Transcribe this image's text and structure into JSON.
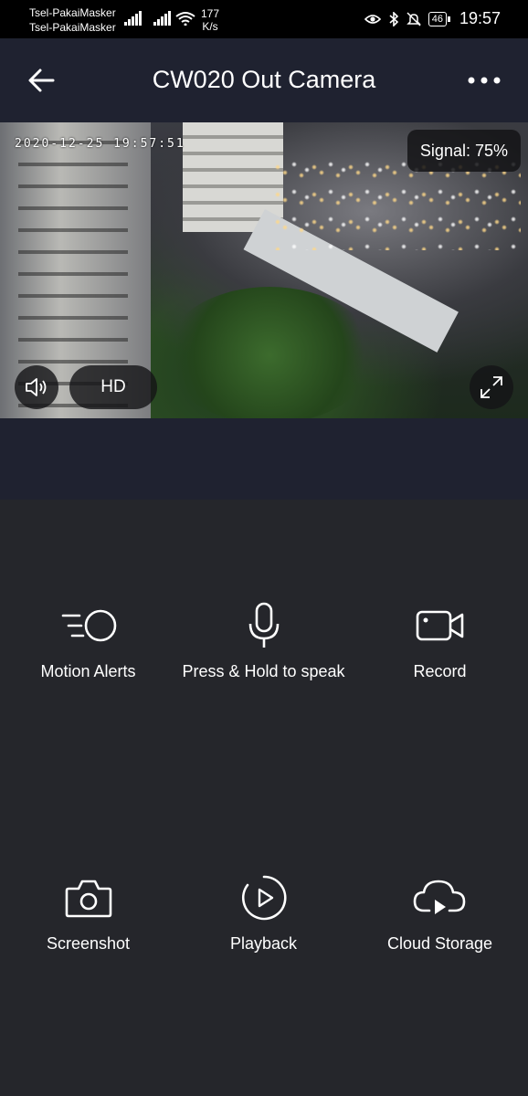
{
  "status_bar": {
    "carrier_1": "Tsel-PakaiMasker",
    "carrier_2": "Tsel-PakaiMasker",
    "net_speed_value": "177",
    "net_speed_unit": "K/s",
    "battery": "46",
    "time": "19:57"
  },
  "header": {
    "title": "CW020 Out Camera"
  },
  "video": {
    "timestamp": "2020-12-25 19:57:51",
    "signal": "Signal: 75%",
    "quality": "HD"
  },
  "controls": [
    {
      "label": "Motion Alerts",
      "icon": "motion-alerts-icon"
    },
    {
      "label": "Press & Hold to speak",
      "icon": "microphone-icon"
    },
    {
      "label": "Record",
      "icon": "video-camera-icon"
    },
    {
      "label": "Screenshot",
      "icon": "camera-icon"
    },
    {
      "label": "Playback",
      "icon": "playback-icon"
    },
    {
      "label": "Cloud Storage",
      "icon": "cloud-play-icon"
    }
  ],
  "colors": {
    "status_bar": "#000000",
    "app_bar": "#1f2230",
    "panel": "#25262b",
    "text": "#ffffff"
  }
}
